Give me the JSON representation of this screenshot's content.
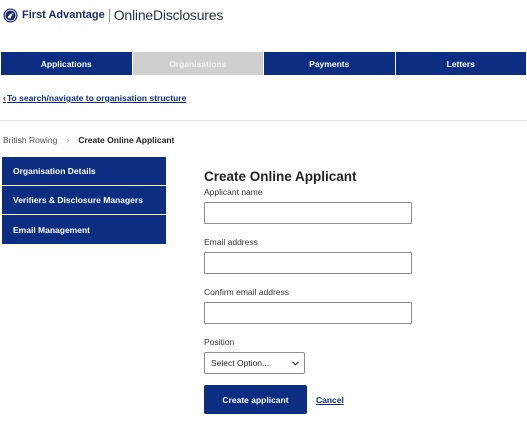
{
  "header": {
    "brand_name": "First Advantage",
    "product_name": "OnlineDisclosures",
    "brand_color": "#1a2b6d"
  },
  "nav": {
    "tabs": [
      {
        "label": "Applications",
        "active": false
      },
      {
        "label": "Organisations",
        "active": true
      },
      {
        "label": "Payments",
        "active": false
      },
      {
        "label": "Letters",
        "active": false
      }
    ],
    "accent_color": "#0b2d82",
    "active_color": "#cfcfcf"
  },
  "back_link": {
    "label": "To search/navigate to organisation structure",
    "icon": "chevron-left-icon"
  },
  "breadcrumb": {
    "parent": "British Rowing",
    "current": "Create Online Applicant",
    "separator_icon": "chevron-right-icon"
  },
  "side_menu": {
    "items": [
      {
        "label": "Organisation Details"
      },
      {
        "label": "Verifiers & Disclosure Managers"
      },
      {
        "label": "Email Management"
      }
    ]
  },
  "form": {
    "title": "Create Online Applicant",
    "fields": {
      "applicant_name": {
        "label": "Applicant name",
        "value": ""
      },
      "email": {
        "label": "Email address",
        "value": ""
      },
      "confirm_email": {
        "label": "Confirm email address",
        "value": ""
      }
    },
    "position": {
      "label": "Position",
      "selected": "Select Option..."
    },
    "submit_label": "Create applicant",
    "cancel_label": "Cancel"
  }
}
